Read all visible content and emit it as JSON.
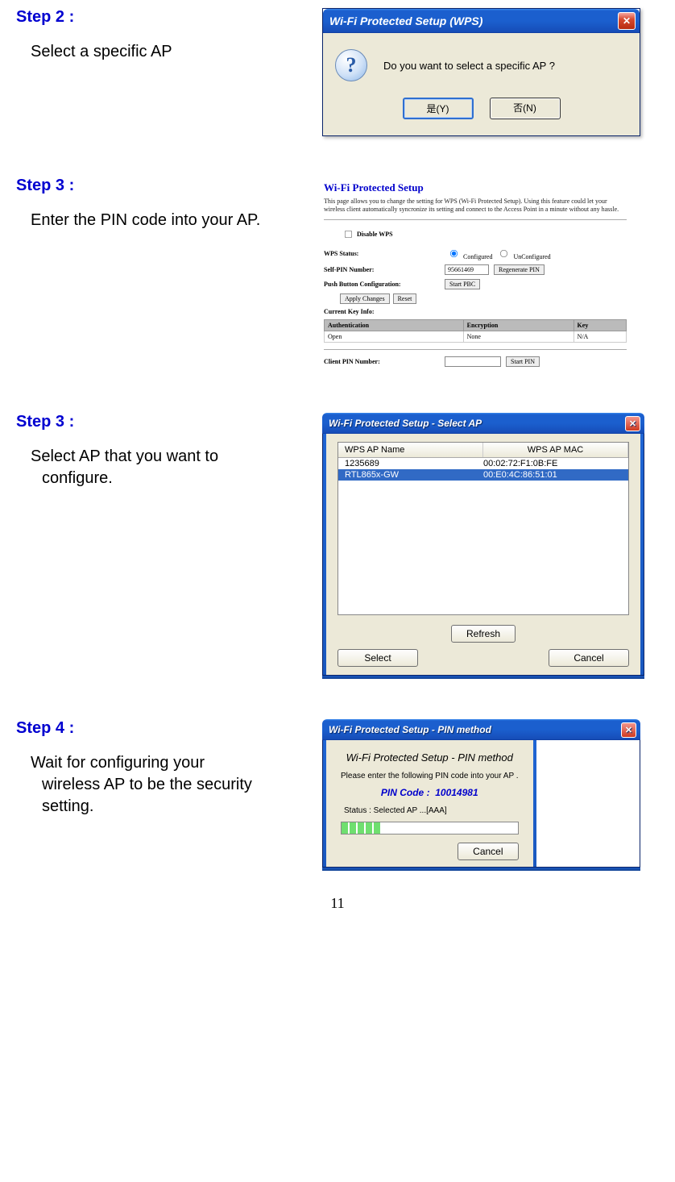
{
  "page_number": "11",
  "steps": [
    {
      "heading": "Step 2 :",
      "desc_lines": [
        "Select a specific AP"
      ]
    },
    {
      "heading": "Step 3 :",
      "desc_lines": [
        "Enter the PIN code into your AP."
      ]
    },
    {
      "heading": "Step 3 :",
      "desc_lines": [
        "Select AP that you want to",
        "configure."
      ]
    },
    {
      "heading": "Step 4 :",
      "desc_lines": [
        "Wait for configuring your",
        "wireless AP to be the security",
        "setting."
      ]
    }
  ],
  "dialog_confirm": {
    "title": "Wi-Fi Protected Setup (WPS)",
    "message": "Do you want to select a specific AP ?",
    "yes": "是(Y)",
    "no": "否(N)"
  },
  "wps_config": {
    "title": "Wi-Fi Protected Setup",
    "intro": "This page allows you to change the setting for WPS (Wi-Fi Protected Setup). Using this feature could let your wireless client automatically syncronize its setting and connect to the Access Point in a minute without any hassle.",
    "disable_label": "Disable WPS",
    "rows": {
      "status_label": "WPS Status:",
      "status_opt1": "Configured",
      "status_opt2": "UnConfigured",
      "selfpin_label": "Self-PIN Number:",
      "selfpin_value": "95661469",
      "regen_btn": "Regenerate PIN",
      "pbc_label": "Push Button Configuration:",
      "pbc_btn": "Start PBC",
      "apply_btn": "Apply Changes",
      "reset_btn": "Reset",
      "key_info_label": "Current Key Info:",
      "clientpin_label": "Client PIN Number:",
      "startpin_btn": "Start PIN"
    },
    "table": {
      "h_auth": "Authentication",
      "h_enc": "Encryption",
      "h_key": "Key",
      "r_auth": "Open",
      "r_enc": "None",
      "r_key": "N/A"
    }
  },
  "select_ap": {
    "title": "Wi-Fi Protected Setup - Select AP",
    "col_name": "WPS AP Name",
    "col_mac": "WPS AP MAC",
    "rows": [
      {
        "name": "1235689",
        "mac": "00:02:72:F1:0B:FE",
        "selected": false
      },
      {
        "name": "RTL865x-GW",
        "mac": "00:E0:4C:86:51:01",
        "selected": true
      }
    ],
    "refresh": "Refresh",
    "select": "Select",
    "cancel": "Cancel"
  },
  "pin_method": {
    "title": "Wi-Fi Protected Setup - PIN method",
    "heading": "Wi-Fi Protected Setup - PIN method",
    "message": "Please enter the following PIN code into your AP .",
    "pin_label": "PIN Code :",
    "pin_value": "10014981",
    "status": "Status :  Selected AP ...[AAA]",
    "cancel": "Cancel"
  }
}
